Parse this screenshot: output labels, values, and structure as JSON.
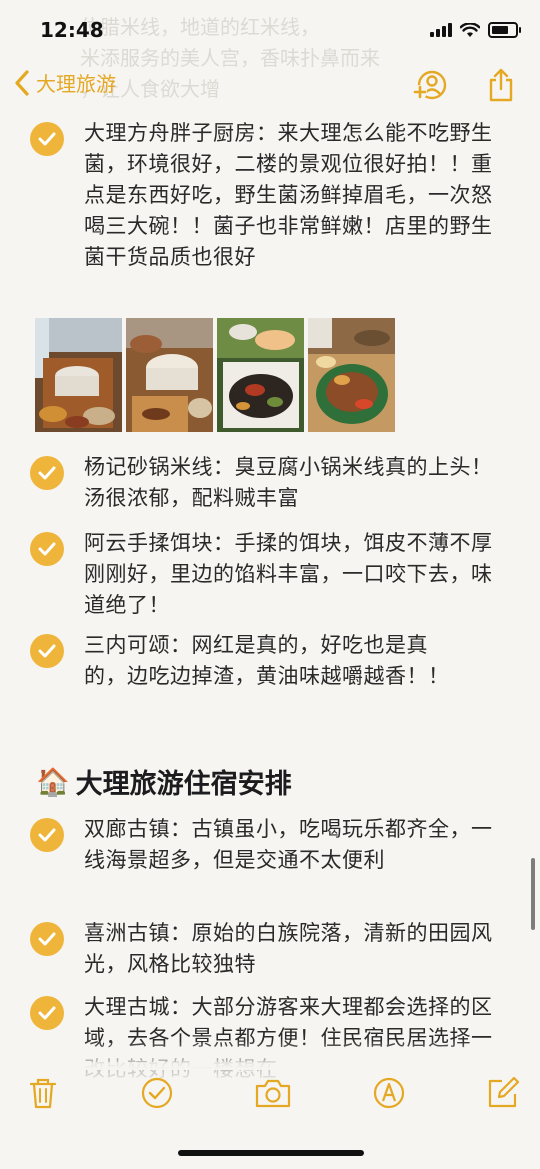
{
  "status": {
    "time": "12:48"
  },
  "ghost_text": "位腊米线，地道的红米线，\n米添服务的美人宫，香味扑鼻而来\n，让人食欲大增",
  "nav": {
    "back_label": "大理旅游"
  },
  "items": [
    {
      "text": "大理方舟胖子厨房：来大理怎么能不吃野生菌，环境很好，二楼的景观位很好拍！！重点是东西好吃，野生菌汤鲜掉眉毛，一次怒喝三大碗！！菌子也非常鲜嫩！店里的野生菌干货品质也很好"
    },
    {
      "text": "杨记砂锅米线：臭豆腐小锅米线真的上头！汤很浓郁，配料贼丰富"
    },
    {
      "text": "阿云手揉饵块：手揉的饵块，饵皮不薄不厚刚刚好，里边的馅料丰富，一口咬下去，味道绝了！"
    },
    {
      "text": "三内可颂：网红是真的，好吃也是真的，边吃边掉渣，黄油味越嚼越香！！"
    }
  ],
  "section": {
    "emoji": "🏠",
    "title": "大理旅游住宿安排"
  },
  "stay_items": [
    {
      "text": "双廊古镇：古镇虽小，吃喝玩乐都齐全，一线海景超多，但是交通不太便利"
    },
    {
      "text": "喜洲古镇：原始的白族院落，清新的田园风光，风格比较独特"
    },
    {
      "text": "大理古城：大部分游客来大理都会选择的区域，去各个景点都方便！住民宿民居选择一改比较好的一楼想在"
    }
  ],
  "colors": {
    "accent": "#e5a823",
    "check": "#efb53a",
    "background": "#f6f5f2"
  },
  "icons": [
    "back-chevron-icon",
    "add-person-icon",
    "share-icon",
    "trash-icon",
    "checklist-icon",
    "camera-icon",
    "markup-pen-icon",
    "compose-icon"
  ]
}
